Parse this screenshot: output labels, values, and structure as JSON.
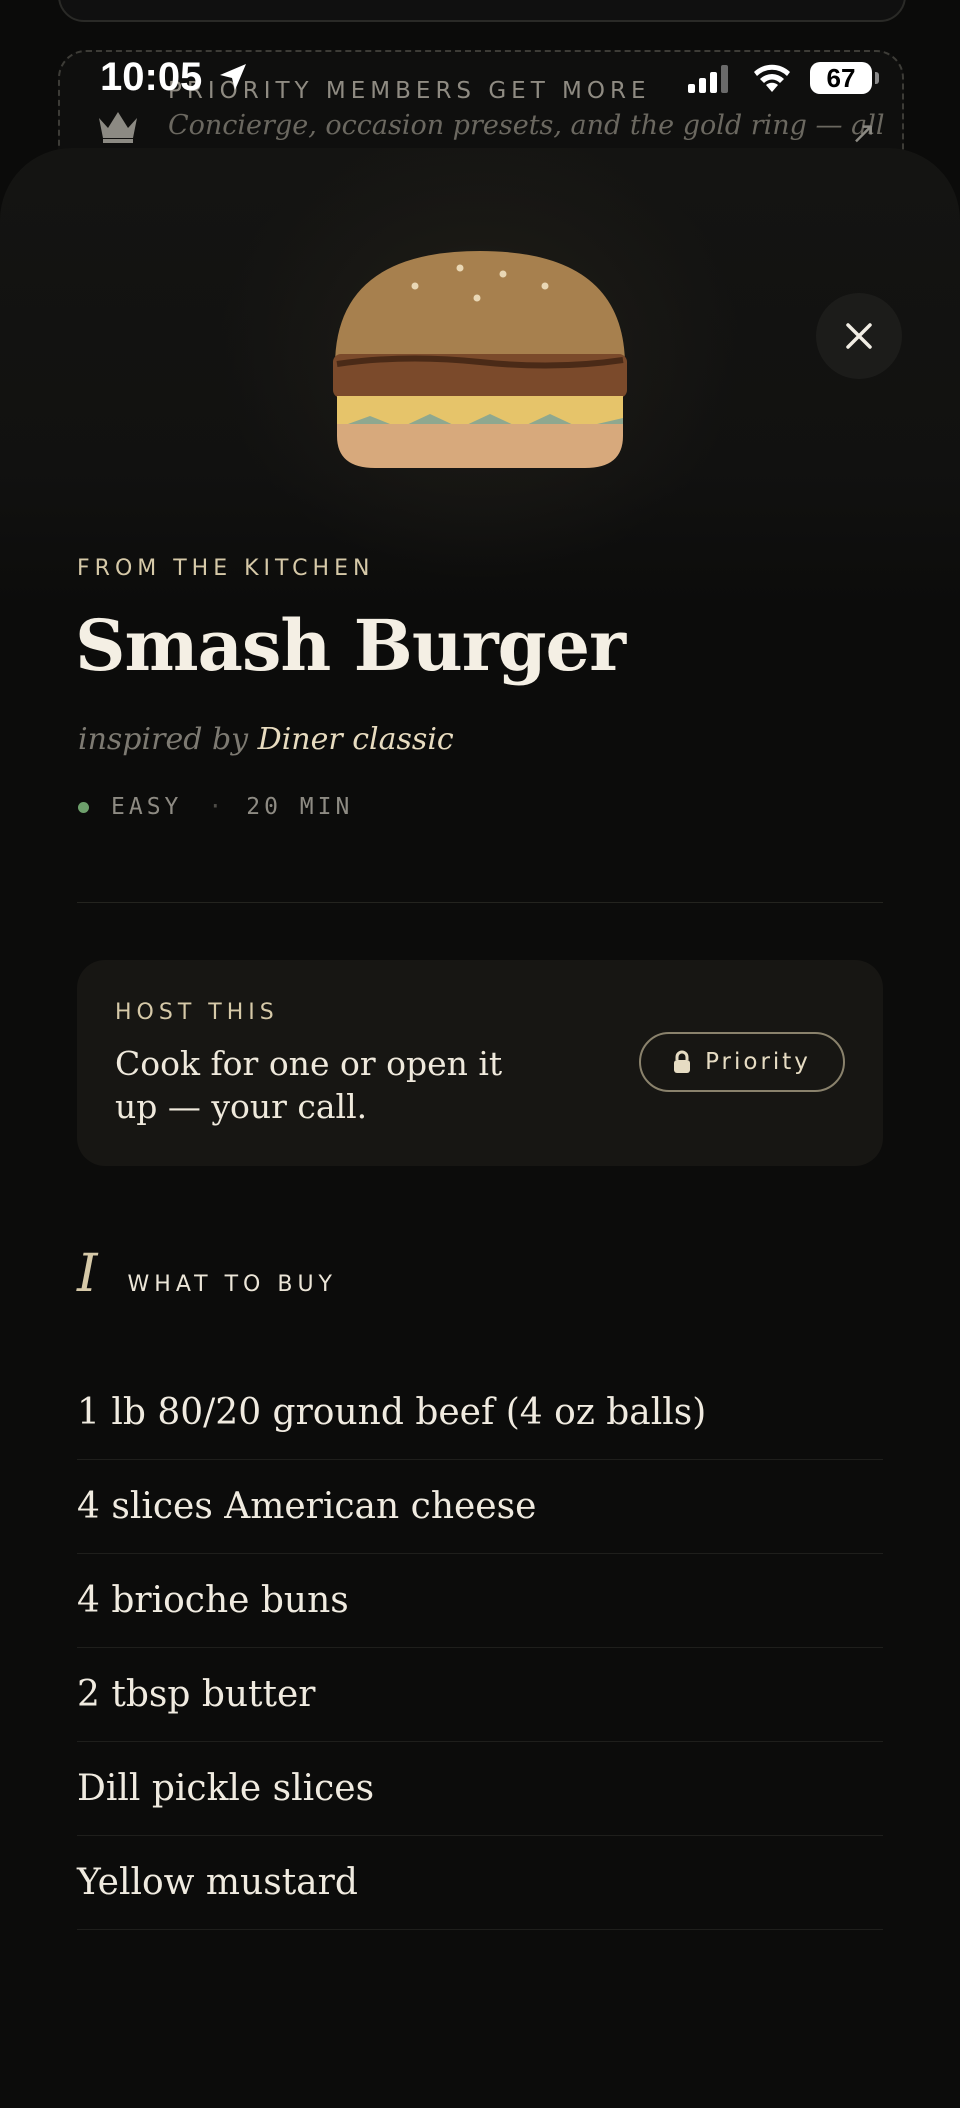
{
  "status_bar": {
    "time": "10:05",
    "battery": "67"
  },
  "promo": {
    "title": "PRIORITY MEMBERS GET MORE",
    "subtitle": "Concierge, occasion presets, and the gold ring — all"
  },
  "recipe": {
    "eyebrow": "FROM THE KITCHEN",
    "title": "Smash Burger",
    "inspired_prefix": "inspired by",
    "inspired_source": "Diner classic",
    "difficulty": "EASY",
    "separator": "·",
    "duration": "20 MIN"
  },
  "host_card": {
    "label": "HOST THIS",
    "text": "Cook for one or open it up — your call.",
    "button_label": "Priority"
  },
  "shopping": {
    "numeral": "I",
    "title": "WHAT TO BUY",
    "items": [
      "1 lb 80/20 ground beef (4 oz balls)",
      "4 slices American cheese",
      "4 brioche buns",
      "2 tbsp butter",
      "Dill pickle slices",
      "Yellow mustard"
    ]
  },
  "colors": {
    "background": "#0b0b0a",
    "accent_gold": "#d6c9a8",
    "difficulty_dot": "#6ea06c",
    "card": "#171613"
  },
  "icons": {
    "promo": "crown-icon",
    "promo_action": "arrow-up-right-icon",
    "close": "close-icon",
    "lock": "lock-icon",
    "location": "location-arrow-icon"
  }
}
